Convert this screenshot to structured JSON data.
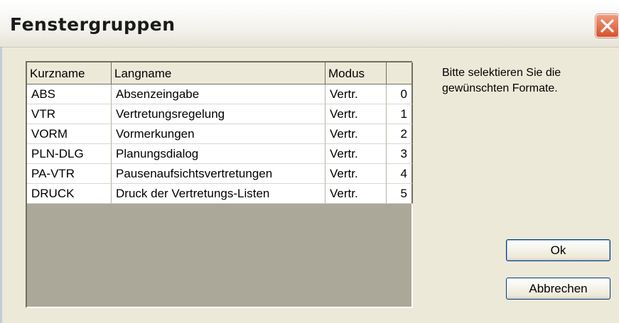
{
  "window": {
    "title": "Fenstergruppen"
  },
  "list": {
    "columns": [
      "Kurzname",
      "Langname",
      "Modus",
      ""
    ],
    "rows": [
      {
        "kurz": "ABS",
        "lang": "Absenzeingabe",
        "modus": "Vertr.",
        "nr": "0"
      },
      {
        "kurz": "VTR",
        "lang": "Vertretungsregelung",
        "modus": "Vertr.",
        "nr": "1"
      },
      {
        "kurz": "VORM",
        "lang": "Vormerkungen",
        "modus": "Vertr.",
        "nr": "2"
      },
      {
        "kurz": "PLN-DLG",
        "lang": "Planungsdialog",
        "modus": "Vertr.",
        "nr": "3"
      },
      {
        "kurz": "PA-VTR",
        "lang": "Pausenaufsichtsvertretungen",
        "modus": "Vertr.",
        "nr": "4"
      },
      {
        "kurz": "DRUCK",
        "lang": "Druck der Vertretungs-Listen",
        "modus": "Vertr.",
        "nr": "5"
      }
    ]
  },
  "info_text": "Bitte selektieren Sie die gewünschten Formate.",
  "buttons": {
    "ok": "Ok",
    "cancel": "Abbrechen"
  },
  "icons": {
    "close": "close-icon"
  },
  "colors": {
    "title_bar": "#f4f3ee",
    "list_background": "#aca899",
    "close_button": "#e06a44"
  }
}
